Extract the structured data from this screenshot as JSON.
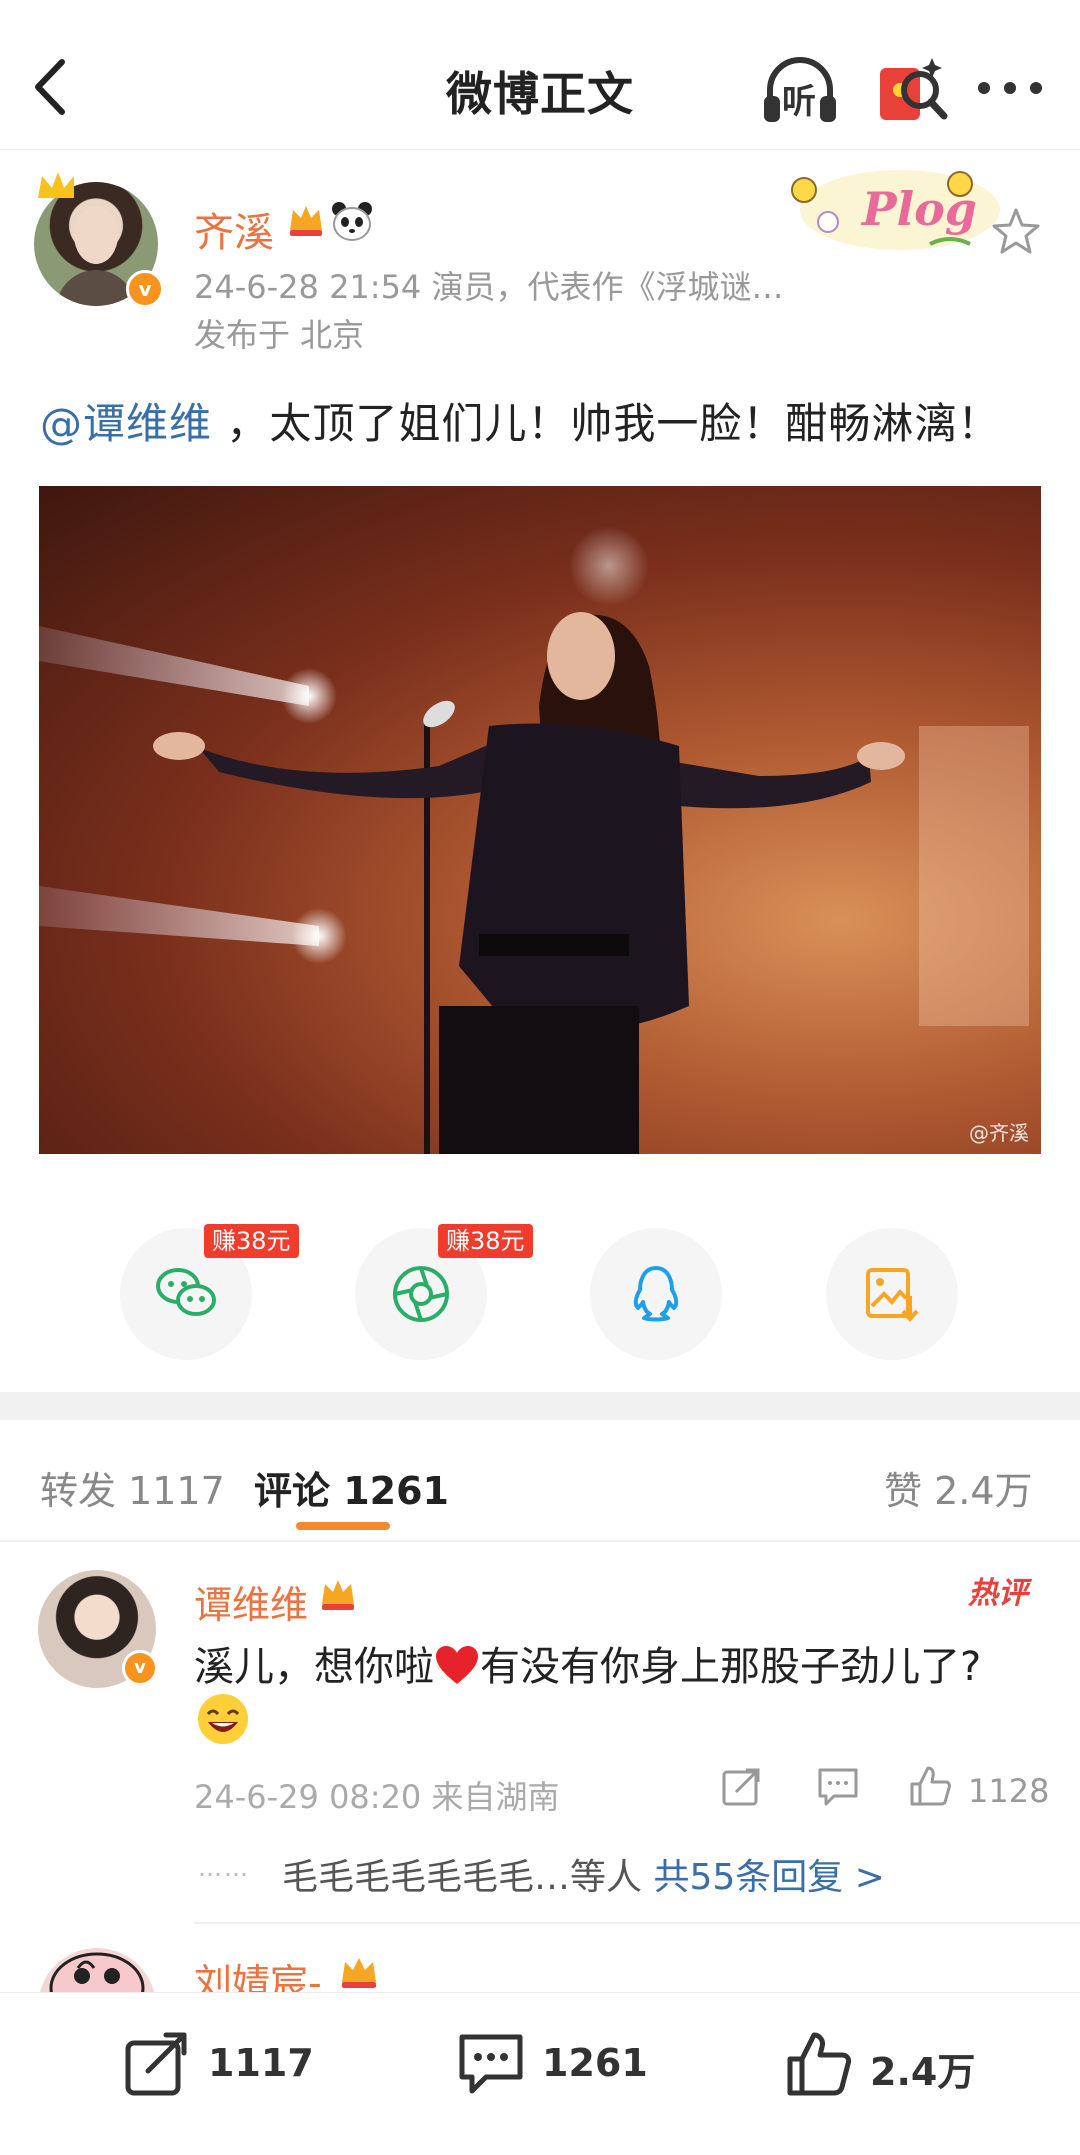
{
  "header": {
    "title": "微博正文",
    "listen_label": "听"
  },
  "post": {
    "author": "齐溪",
    "verified_mark": "v",
    "meta": "24-6-28 21:54  演员，代表作《浮城谜…",
    "location": "发布于 北京",
    "sticker_text": "Plog",
    "mention": "@谭维维",
    "text": " ，太顶了姐们儿！帅我一脸！酣畅淋漓！",
    "photo_watermark": "@齐溪"
  },
  "share": {
    "reward_wechat": "赚38元",
    "reward_moments": "赚38元"
  },
  "tabs": {
    "repost": "转发 1117",
    "comment": "评论 1261",
    "likes": "赞 2.4万"
  },
  "comment": {
    "author": "谭维维",
    "hot_label": "热评",
    "text_part1": "溪儿，想你啦",
    "text_part2": "有没有你身上那股子劲儿了?",
    "meta": "24-6-29 08:20  来自湖南",
    "like_count": "1128",
    "reply_dots": "……",
    "reply_users": "毛毛毛毛毛毛毛…等人 ",
    "reply_link": "共55条回复 >"
  },
  "comment2": {
    "author": "刘婧宸-"
  },
  "bottombar": {
    "repost_count": "1117",
    "comment_count": "1261",
    "like_count": "2.4万"
  },
  "colors": {
    "accent": "#eb7340",
    "link": "#3a6ea8",
    "reward": "#f03c2d",
    "tab_underline": "#f38a32"
  }
}
